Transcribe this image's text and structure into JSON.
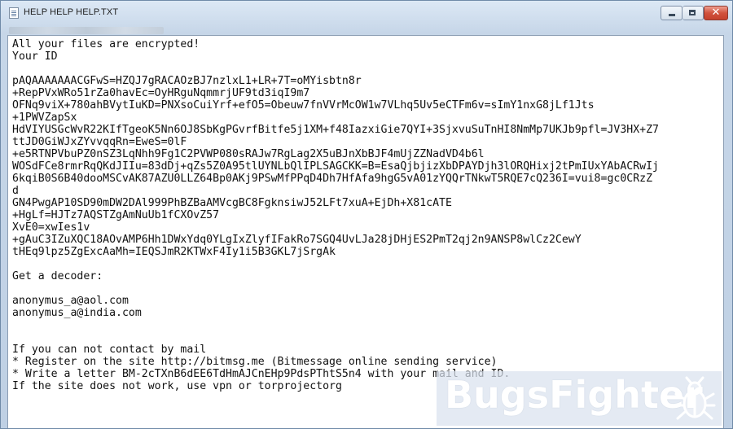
{
  "window": {
    "title": "HELP HELP HELP.TXT"
  },
  "titlebar_controls": {
    "minimize_icon": "minimize-icon",
    "maximize_icon": "maximize-icon",
    "close_glyph": "✕"
  },
  "document": {
    "lines": [
      "All your files are encrypted!",
      "Your ID",
      "",
      "pAQAAAAAAACGFwS=HZQJ7gRACAOzBJ7nzlxL1+LR+7T=oMYisbtn8r",
      "+RepPVxWRo51rZa0havEc=OyHRguNqmmrjUF9td3iqI9m7",
      "OFNq9viX+780ahBVytIuKD=PNXsoCuiYrf+efO5=Obeuw7fnVVrMcOW1w7VLhq5Uv5eCTFm6v=sImY1nxG8jLf1Jts",
      "+1PWVZapSx",
      "HdVIYUSGcWvR22KIfTgeoK5Nn6OJ8SbKgPGvrfBitfe5j1XM+f48IazxiGie7QYI+3SjxvuSuTnHI8NmMp7UKJb9pfl=JV3HX+Z7",
      "ttJD0GiWJxZYvvqqRn=EweS=0lF",
      "+e5RTNPVbuPZ0nSZ3LqNhh9Fg1C2PVWP080sRAJw7RgLag2X5uBJnXbBJF4mUjZZNadVD4b6l",
      "WOSdFCe8rmrRqQKdJIIu=83dDj+qZs5Z0A95tlUYNLbQlIPLSAGCKK=B=EsaQjbjizXbDPAYDjh3lORQHixj2tPmIUxYAbACRwIj",
      "6kqiB0S6B40dooMSCvAK87AZU0LLZ64Bp0AKj9PSwMfPPqD4Dh7HfAfa9hgG5vA01zYQQrTNkwT5RQE7cQ236I=vui8=gc0CRzZ",
      "d",
      "GN4PwgAP10SD90mDW2DAl999PhBZBaAMVcgBC8FgknsiwJ52LFt7xuA+EjDh+X81cATE",
      "+HgLf=HJTz7AQSTZgAmNuUb1fCXOvZ57",
      "XvE0=xwIes1v",
      "+gAuC3IZuXQC18AOvAMP6Hh1DWxYdq0YLgIxZlyfIFakRo7SGQ4UvLJa28jDHjES2PmT2qj2n9ANSP8wlCz2CewY",
      "tHEq9lpz5ZgExcAaMh=IEQSJmR2KTWxF4Iy1i5B3GKL7jSrgAk",
      "",
      "Get a decoder:",
      "",
      "anonymus_a@aol.com",
      "anonymus_a@india.com",
      "",
      "",
      "If you can not contact by mail",
      "* Register on the site http://bitmsg.me (Bitmessage online sending service)",
      "* Write a letter BM-2cTXnB6dEE6TdHmAJCnEHp9PdsPThtS5n4 with your mail and ID.",
      "If the site does not work, use vpn or torprojectorg"
    ]
  },
  "watermark": {
    "text": "BugsFighter",
    "icon": "bug-icon"
  }
}
